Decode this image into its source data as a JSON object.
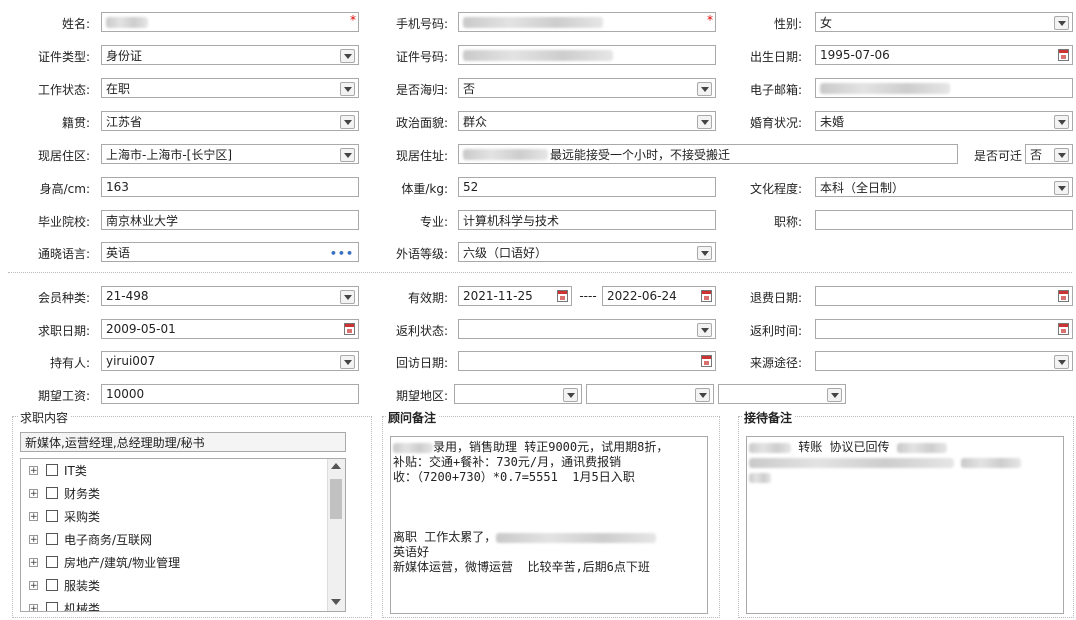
{
  "basic": {
    "name_label": "姓名:",
    "phone_label": "手机号码:",
    "gender_label": "性别:",
    "gender_value": "女",
    "idtype_label": "证件类型:",
    "idtype_value": "身份证",
    "idno_label": "证件号码:",
    "birth_label": "出生日期:",
    "birth_value": "1995-07-06",
    "work_label": "工作状态:",
    "work_value": "在职",
    "returnee_label": "是否海归:",
    "returnee_value": "否",
    "email_label": "电子邮箱:",
    "native_label": "籍贯:",
    "native_value": "江苏省",
    "political_label": "政治面貌:",
    "political_value": "群众",
    "marital_label": "婚育状况:",
    "marital_value": "未婚",
    "residence_label": "现居住区:",
    "residence_value": "上海市-上海市-[长宁区]",
    "address_label": "现居住址:",
    "address_value": "最远能接受一个小时，不接受搬迁",
    "negotiable_label": "是否可迁",
    "negotiable_value": "否",
    "height_label": "身高/cm:",
    "height_value": "163",
    "weight_label": "体重/kg:",
    "weight_value": "52",
    "education_label": "文化程度:",
    "education_value": "本科（全日制）",
    "school_label": "毕业院校:",
    "school_value": "南京林业大学",
    "major_label": "专业:",
    "major_value": "计算机科学与技术",
    "title_label": "职称:",
    "title_value": "",
    "language_label": "通晓语言:",
    "language_value": "英语",
    "ellipsis": "•••",
    "langlevel_label": "外语等级:",
    "langlevel_value": "六级（口语好）",
    "required_mark": "*"
  },
  "member": {
    "type_label": "会员种类:",
    "type_value": "21-498",
    "validity_label": "有效期:",
    "validity_from": "2021-11-25",
    "validity_sep": "----",
    "validity_to": "2022-06-24",
    "refund_date_label": "退费日期:",
    "jobseek_date_label": "求职日期:",
    "jobseek_date_value": "2009-05-01",
    "rebate_status_label": "返利状态:",
    "rebate_time_label": "返利时间:",
    "holder_label": "持有人:",
    "holder_value": "yirui007",
    "revisit_label": "回访日期:",
    "source_label": "来源途径:",
    "salary_label": "期望工资:",
    "salary_value": "10000",
    "region_label": "期望地区:"
  },
  "job_content": {
    "title": "求职内容",
    "summary": "新媒体,运营经理,总经理助理/秘书",
    "tree": [
      "IT类",
      "财务类",
      "采购类",
      "电子商务/互联网",
      "房地产/建筑/物业管理",
      "服装类",
      "机械类"
    ],
    "expand_glyph": "+"
  },
  "advisor_notes": {
    "title": "顾问备注",
    "lines": [
      "录用，销售助理 转正9000元，试用期8折，",
      "补贴：交通+餐补：730元/月，通讯费报销",
      "收：（7200+730）*0.7=5551  1月5日入职",
      "",
      "",
      "",
      "离职 工作太累了，",
      "英语好",
      "新媒体运营，微博运营  比较辛苦,后期6点下班"
    ]
  },
  "reception_notes": {
    "title": "接待备注",
    "line1": "转账 协议已回传"
  }
}
